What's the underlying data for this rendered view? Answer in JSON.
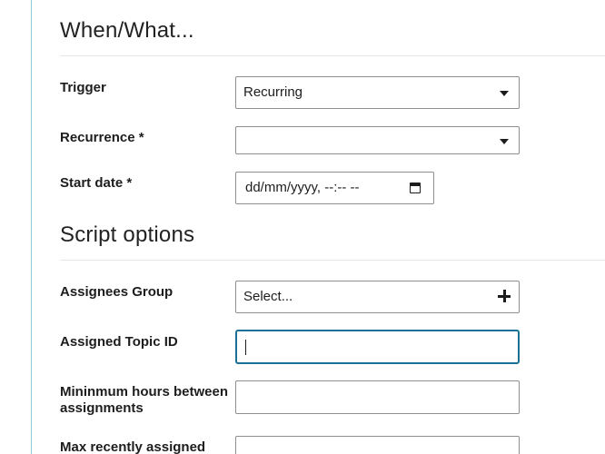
{
  "sections": {
    "when_what": {
      "heading": "When/What..."
    },
    "script_options": {
      "heading": "Script options"
    }
  },
  "fields": {
    "trigger": {
      "label": "Trigger",
      "value": "Recurring",
      "icon": "chevron-down-icon"
    },
    "recurrence": {
      "label": "Recurrence *",
      "value": "",
      "icon": "chevron-down-icon"
    },
    "start_date": {
      "label": "Start date *",
      "value": "dd/mm/yyyy, --:-- --",
      "icon": "calendar-icon"
    },
    "assignees_group": {
      "label": "Assignees Group",
      "value": "Select...",
      "icon": "plus-icon"
    },
    "assigned_topic_id": {
      "label": "Assigned Topic ID",
      "value": ""
    },
    "min_hours": {
      "label": "Mininmum hours between assignments",
      "value": ""
    },
    "max_recently_assigned": {
      "label": "Max recently assigned",
      "value": ""
    }
  },
  "colors": {
    "focus_border": "#1c6f95",
    "left_rule": "#8fc7dd"
  }
}
